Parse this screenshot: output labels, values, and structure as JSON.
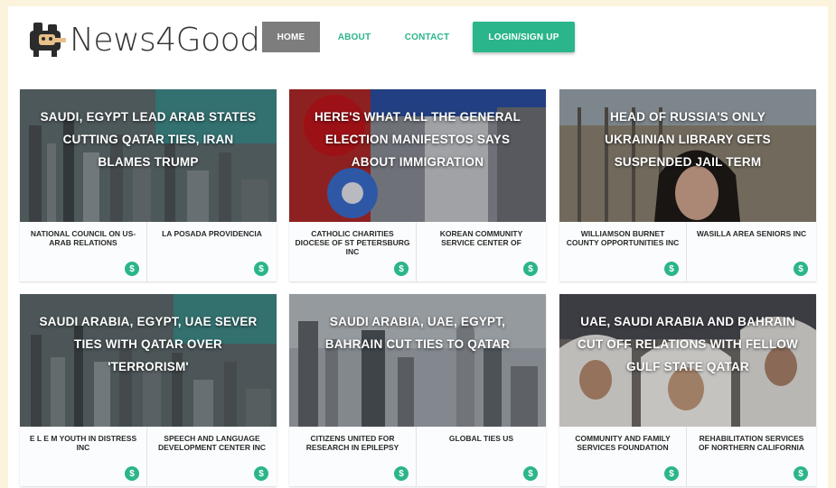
{
  "brand": {
    "name": "News4Good"
  },
  "nav": {
    "items": [
      "HOME",
      "ABOUT",
      "CONTACT"
    ],
    "login": "LOGIN/SIGN UP"
  },
  "colors": {
    "accent": "#2bb58a",
    "nav_active": "#7d7d7d",
    "frame": "#fcf3dc"
  },
  "cards": [
    {
      "headline": "SAUDI, EGYPT LEAD ARAB STATES CUTTING QATAR TIES, IRAN BLAMES TRUMP",
      "image": "aerial-city-photo",
      "charities": [
        "NATIONAL COUNCIL ON US-ARAB RELATIONS",
        "LA POSADA PROVIDENCIA"
      ]
    },
    {
      "headline": "HERE'S WHAT ALL THE GENERAL ELECTION MANIFESTOS SAYS ABOUT IMMIGRATION",
      "image": "labour-rosette-photo",
      "charities": [
        "CATHOLIC CHARITIES DIOCESE OF ST PETERSBURG INC",
        "KOREAN COMMUNITY SERVICE CENTER OF"
      ]
    },
    {
      "headline": "HEAD OF RUSSIA'S ONLY UKRAINIAN LIBRARY GETS SUSPENDED JAIL TERM",
      "image": "woman-portrait-photo",
      "charities": [
        "WILLIAMSON BURNET COUNTY OPPORTUNITIES INC",
        "WASILLA AREA SENIORS INC"
      ]
    },
    {
      "headline": "SAUDI ARABIA, EGYPT, UAE SEVER TIES WITH QATAR OVER 'TERRORISM'",
      "image": "aerial-city-photo",
      "charities": [
        "E L E M YOUTH IN DISTRESS INC",
        "SPEECH AND LANGUAGE DEVELOPMENT CENTER INC"
      ]
    },
    {
      "headline": "SAUDI ARABIA, UAE, EGYPT, BAHRAIN CUT TIES TO QATAR",
      "image": "skyline-photo",
      "charities": [
        "CITIZENS UNITED FOR RESEARCH IN EPILEPSY",
        "GLOBAL TIES US"
      ]
    },
    {
      "headline": "UAE, SAUDI ARABIA AND BAHRAIN CUT OFF RELATIONS WITH FELLOW GULF STATE QATAR",
      "image": "gulf-leaders-photo",
      "charities": [
        "COMMUNITY AND FAMILY SERVICES FOUNDATION",
        "REHABILITATION SERVICES OF NORTHERN CALIFORNIA"
      ]
    }
  ],
  "donate_symbol": "$"
}
